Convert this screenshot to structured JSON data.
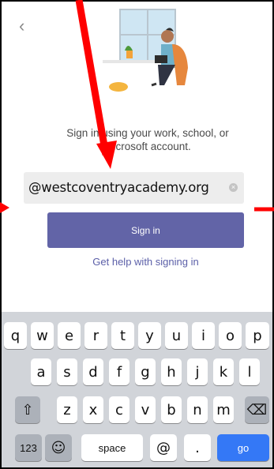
{
  "nav": {
    "back_icon": "chevron-left-icon"
  },
  "prompt": {
    "line1": "Sign in using your work, school, or",
    "line2": "Microsoft account."
  },
  "email": {
    "value": "@westcoventryacademy.org"
  },
  "buttons": {
    "sign_in": "Sign in"
  },
  "links": {
    "help": "Get help with signing in"
  },
  "keyboard": {
    "row1": [
      "q",
      "w",
      "e",
      "r",
      "t",
      "y",
      "u",
      "i",
      "o",
      "p"
    ],
    "row2": [
      "a",
      "s",
      "d",
      "f",
      "g",
      "h",
      "j",
      "k",
      "l"
    ],
    "row3": [
      "z",
      "x",
      "c",
      "v",
      "b",
      "n",
      "m"
    ],
    "numbers": "123",
    "space": "space",
    "at": "@",
    "dot": ".",
    "go": "go"
  },
  "colors": {
    "accent": "#6264a7",
    "link": "#5b5fa8",
    "go_key": "#3478f6",
    "annotation": "#ff0000"
  }
}
